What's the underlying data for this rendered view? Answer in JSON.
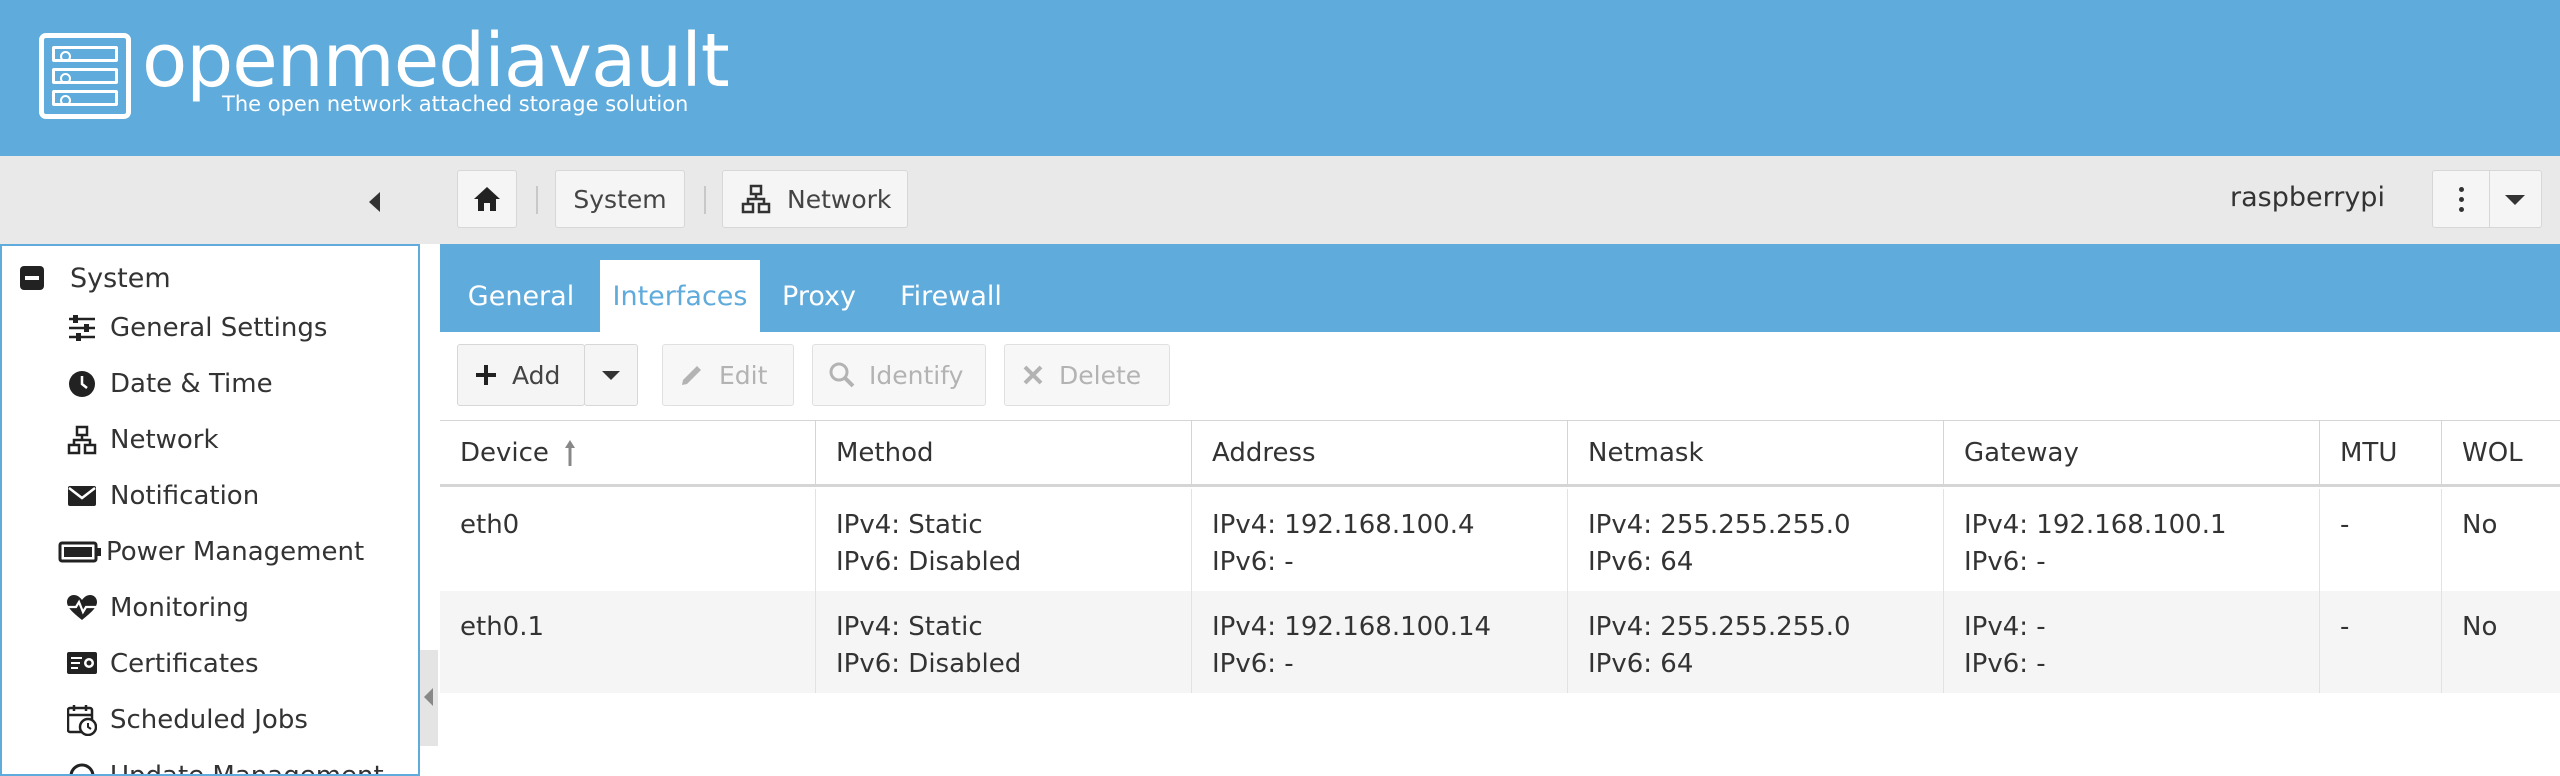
{
  "header": {
    "title": "openmediavault",
    "subtitle": "The open network attached storage solution",
    "logo_icon": "server-rack-icon",
    "background": "#5fabdc"
  },
  "toolbar": {
    "collapse_icon": "caret-left-icon",
    "breadcrumb": [
      {
        "icon": "home-icon",
        "label": ""
      },
      {
        "icon": "",
        "label": "System"
      },
      {
        "icon": "network-icon",
        "label": "Network"
      }
    ],
    "hostname": "raspberrypi",
    "menu_icon": "kebab-menu-icon",
    "dropdown_icon": "caret-down-icon"
  },
  "sidebar": {
    "group": {
      "label": "System",
      "icon": "collapse-minus-icon"
    },
    "items": [
      {
        "label": "General Settings",
        "icon": "sliders-icon"
      },
      {
        "label": "Date & Time",
        "icon": "clock-icon"
      },
      {
        "label": "Network",
        "icon": "network-icon"
      },
      {
        "label": "Notification",
        "icon": "envelope-icon"
      },
      {
        "label": "Power Management",
        "icon": "battery-icon"
      },
      {
        "label": "Monitoring",
        "icon": "heartbeat-icon"
      },
      {
        "label": "Certificates",
        "icon": "certificate-icon"
      },
      {
        "label": "Scheduled Jobs",
        "icon": "calendar-clock-icon"
      },
      {
        "label": "Update Management",
        "icon": "update-icon"
      }
    ]
  },
  "tabs": [
    {
      "label": "General",
      "active": false
    },
    {
      "label": "Interfaces",
      "active": true
    },
    {
      "label": "Proxy",
      "active": false
    },
    {
      "label": "Firewall",
      "active": false
    }
  ],
  "actions": {
    "add": "Add",
    "edit": "Edit",
    "identify": "Identify",
    "delete": "Delete"
  },
  "grid": {
    "columns": [
      "Device",
      "Method",
      "Address",
      "Netmask",
      "Gateway",
      "MTU",
      "WOL"
    ],
    "sort": {
      "column": "Device",
      "direction": "ascending"
    },
    "rows": [
      {
        "device": "eth0",
        "method": [
          "IPv4: Static",
          "IPv6: Disabled"
        ],
        "address": [
          "IPv4: 192.168.100.4",
          "IPv6: -"
        ],
        "netmask": [
          "IPv4: 255.255.255.0",
          "IPv6: 64"
        ],
        "gateway": [
          "IPv4: 192.168.100.1",
          "IPv6: -"
        ],
        "mtu": "-",
        "wol": "No"
      },
      {
        "device": "eth0.1",
        "method": [
          "IPv4: Static",
          "IPv6: Disabled"
        ],
        "address": [
          "IPv4: 192.168.100.14",
          "IPv6: -"
        ],
        "netmask": [
          "IPv4: 255.255.255.0",
          "IPv6: 64"
        ],
        "gateway": [
          "IPv4: -",
          "IPv6: -"
        ],
        "mtu": "-",
        "wol": "No"
      }
    ]
  },
  "colors": {
    "accent": "#5fabdc",
    "toolbar_bg": "#e9e9e9",
    "alt_row": "#f5f5f5"
  }
}
